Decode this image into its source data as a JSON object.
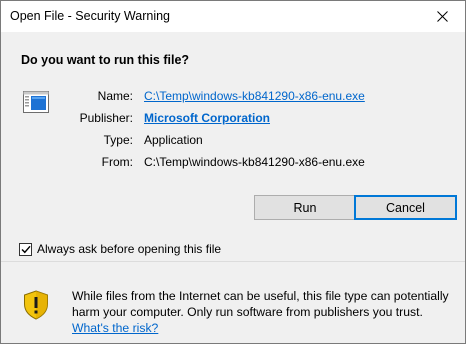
{
  "window": {
    "title": "Open File - Security Warning"
  },
  "prompt": {
    "question": "Do you want to run this file?"
  },
  "details": {
    "name_label": "Name:",
    "name_value": "C:\\Temp\\windows-kb841290-x86-enu.exe",
    "publisher_label": "Publisher:",
    "publisher_value": "Microsoft Corporation",
    "type_label": "Type:",
    "type_value": "Application",
    "from_label": "From:",
    "from_value": "C:\\Temp\\windows-kb841290-x86-enu.exe"
  },
  "buttons": {
    "run_label": "Run",
    "cancel_label": "Cancel"
  },
  "checkbox": {
    "label": "Always ask before opening this file",
    "checked": true
  },
  "footer": {
    "warning_text": "While files from the Internet can be useful, this file type can potentially harm your computer. Only run software from publishers you trust.",
    "link_text": "What's the risk?"
  },
  "icons": {
    "close": "close-icon",
    "app": "application-icon",
    "shield": "shield-warning-icon",
    "check": "checkmark-icon"
  },
  "colors": {
    "link": "#0066cc",
    "focus_border": "#0078d7",
    "shield_yellow": "#f2c40e"
  }
}
